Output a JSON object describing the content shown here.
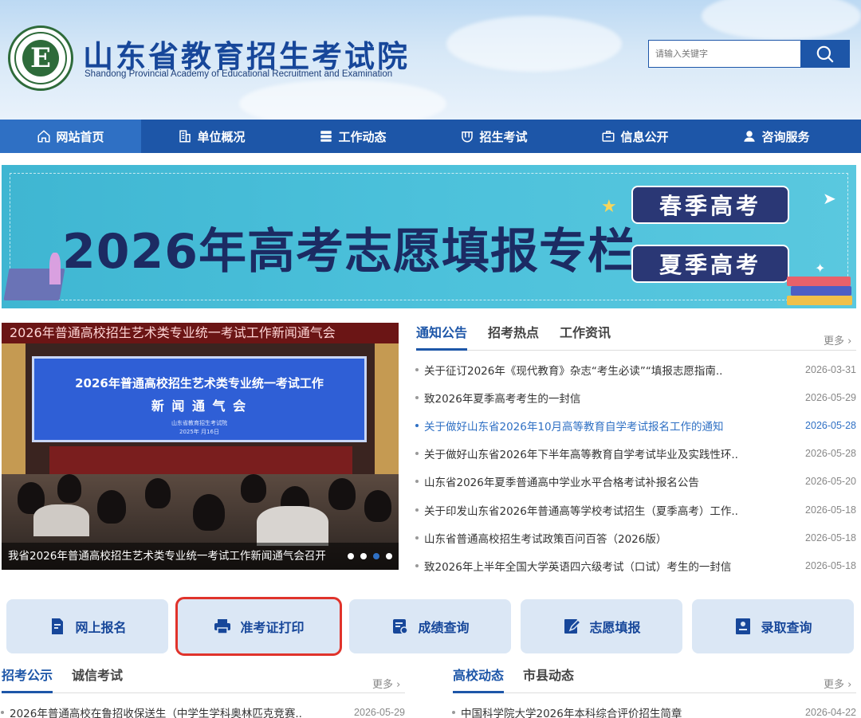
{
  "header": {
    "logo_letter": "E",
    "title": "山东省教育招生考试院",
    "subtitle": "Shandong Provincial Academy of Educational Recruitment and Examination",
    "search_placeholder": "请输入关键字"
  },
  "nav": {
    "items": [
      {
        "label": "网站首页",
        "icon": "home-icon"
      },
      {
        "label": "单位概况",
        "icon": "building-icon"
      },
      {
        "label": "工作动态",
        "icon": "server-icon"
      },
      {
        "label": "招生考试",
        "icon": "badge-icon"
      },
      {
        "label": "信息公开",
        "icon": "inbox-icon"
      },
      {
        "label": "咨询服务",
        "icon": "service-icon"
      }
    ],
    "active_index": 0
  },
  "banner": {
    "title": "2026年高考志愿填报专栏",
    "spring": "春季高考",
    "summer": "夏季高考"
  },
  "news_photo": {
    "top_caption": "2026年普通高校招生艺术类专业统一考试工作新闻通气会",
    "screen_line1": "2026年普通高校招生艺术类专业统一考试工作",
    "screen_line2": "新 闻 通 气 会",
    "screen_line3": "山东省教育招生考试院",
    "screen_line4": "2025年 月16日",
    "caption": "我省2026年普通高校招生艺术类专业统一考试工作新闻通气会召开",
    "slide_count": 4,
    "active_slide": 2
  },
  "notices": {
    "tabs": [
      "通知公告",
      "招考热点",
      "工作资讯"
    ],
    "active_tab": 0,
    "more": "更多",
    "items": [
      {
        "text": "关于征订2026年《现代教育》杂志“考生必读”“填报志愿指南..",
        "date": "2026-03-31"
      },
      {
        "text": "致2026年夏季高考考生的一封信",
        "date": "2026-05-29"
      },
      {
        "text": "关于做好山东省2026年10月高等教育自学考试报名工作的通知",
        "date": "2026-05-28",
        "highlight": true
      },
      {
        "text": "关于做好山东省2026年下半年高等教育自学考试毕业及实践性环..",
        "date": "2026-05-28"
      },
      {
        "text": "山东省2026年夏季普通高中学业水平合格考试补报名公告",
        "date": "2026-05-20"
      },
      {
        "text": "关于印发山东省2026年普通高等学校考试招生（夏季高考）工作..",
        "date": "2026-05-18"
      },
      {
        "text": "山东省普通高校招生考试政策百问百答（2026版）",
        "date": "2026-05-18"
      },
      {
        "text": "致2026年上半年全国大学英语四六级考试（口试）考生的一封信",
        "date": "2026-05-18"
      }
    ]
  },
  "services": [
    {
      "label": "网上报名",
      "icon": "form-icon"
    },
    {
      "label": "准考证打印",
      "icon": "printer-icon"
    },
    {
      "label": "成绩查询",
      "icon": "score-icon"
    },
    {
      "label": "志愿填报",
      "icon": "edit-icon"
    },
    {
      "label": "录取查询",
      "icon": "admission-icon"
    }
  ],
  "services_selected": 1,
  "left_section": {
    "tabs": [
      "招考公示",
      "诚信考试"
    ],
    "more": "更多",
    "items": [
      {
        "text": "2026年普通高校在鲁招收保送生（中学生学科奥林匹克竞赛..",
        "date": "2026-05-29"
      }
    ]
  },
  "right_section": {
    "tabs": [
      "高校动态",
      "市县动态"
    ],
    "more": "更多",
    "items": [
      {
        "text": "中国科学院大学2026年本科综合评价招生简章",
        "date": "2026-04-22"
      }
    ]
  },
  "colors": {
    "brand_blue": "#1d56a8",
    "active_nav": "#2f70c4",
    "highlight_red": "#e0332b",
    "banner_teal": "#4cc1db"
  }
}
